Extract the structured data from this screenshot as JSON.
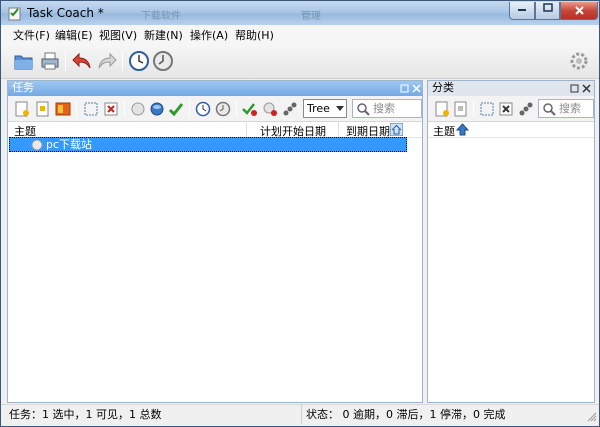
{
  "window": {
    "title": "Task Coach *",
    "background_titles": [
      "下载软件",
      "管理"
    ]
  },
  "menu": [
    "文件(F)",
    "编辑(E)",
    "视图(V)",
    "新建(N)",
    "操作(A)",
    "帮助(H)"
  ],
  "toolbar": {
    "open_icon": "open-folder-icon",
    "print_icon": "printer-icon",
    "undo_icon": "undo-arrow-icon",
    "redo_icon": "redo-arrow-icon",
    "clock_icon": "clock-icon",
    "clock2_icon": "clock-alt-icon",
    "settings_icon": "gear-icon"
  },
  "tasks_panel": {
    "title": "任务",
    "view_mode": "Tree",
    "search_placeholder": "搜索",
    "columns": [
      "主题",
      "计划开始日期",
      "到期日期"
    ],
    "rows": [
      {
        "subject": "pc下载站",
        "planned_start": "",
        "due": ""
      }
    ]
  },
  "categories_panel": {
    "title": "分类",
    "search_placeholder": "搜索",
    "columns": [
      "主题"
    ]
  },
  "statusbar": {
    "left": "任务：1 选中，1 可见，1 总数",
    "right": "状态： 0 逾期，0 滞后，1 停滞，0 完成"
  },
  "colors": {
    "selection": "#3399ff",
    "panel_active": "#73a9e4",
    "close_button": "#c8463a"
  }
}
